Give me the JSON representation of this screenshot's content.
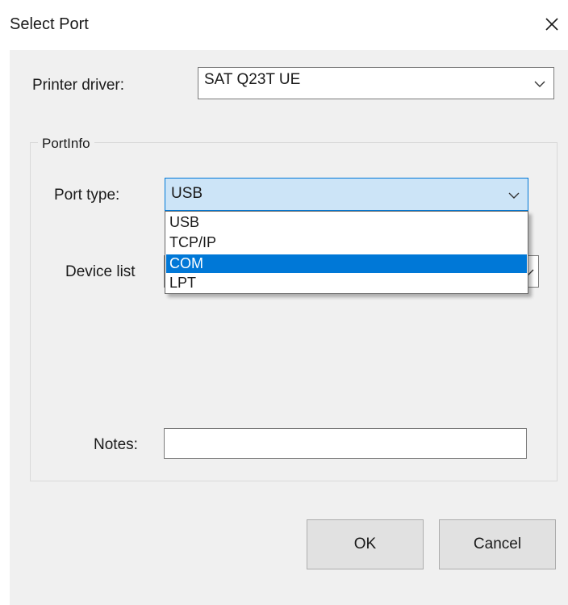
{
  "dialog": {
    "title": "Select Port"
  },
  "printer_driver": {
    "label": "Printer driver:",
    "value": "SAT Q23T UE"
  },
  "port_info": {
    "group_label": "PortInfo",
    "port_type": {
      "label": "Port type:",
      "value": "USB",
      "options": [
        "USB",
        "TCP/IP",
        "COM",
        "LPT"
      ],
      "highlighted": "COM"
    },
    "device_list": {
      "label": "Device list"
    },
    "notes": {
      "label": "Notes:",
      "value": ""
    }
  },
  "buttons": {
    "ok": "OK",
    "cancel": "Cancel"
  },
  "icons": {
    "close": "close-icon",
    "dropdown": "chevron-down-icon"
  },
  "colors": {
    "accent": "#0078d7",
    "focus_fill": "#cce4f7",
    "client_bg": "#f0f0f0",
    "button_bg": "#e1e1e1"
  }
}
